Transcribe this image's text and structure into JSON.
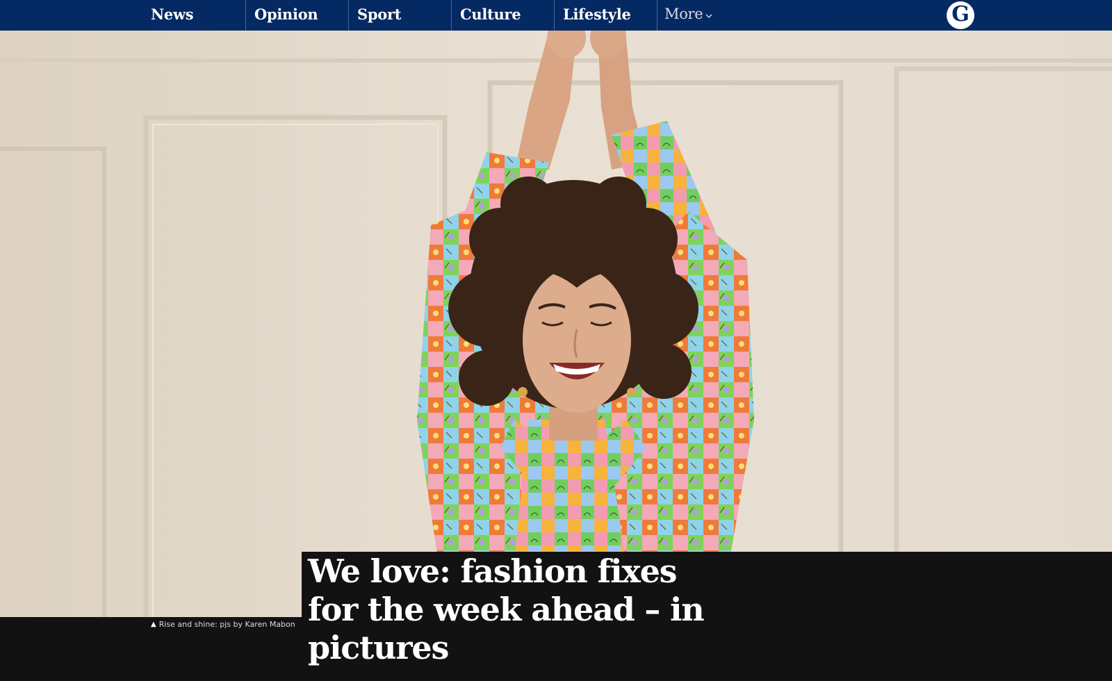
{
  "nav": {
    "items": [
      {
        "label": "News"
      },
      {
        "label": "Opinion"
      },
      {
        "label": "Sport"
      },
      {
        "label": "Culture"
      },
      {
        "label": "Lifestyle"
      }
    ],
    "more_label": "More",
    "logo_glyph": "G"
  },
  "hero": {
    "image": "woman in colorful patchwork print pyjamas with curly hair, arms raised, smiling"
  },
  "caption": {
    "icon": "triangle-up-icon",
    "text": "Rise and shine: pjs by Karen Mabon"
  },
  "article": {
    "headline": "We love: fashion fixes for the week ahead – in pictures"
  },
  "colors": {
    "nav_bg": "#052962",
    "band_bg": "#121212",
    "wall": "#e6dccf"
  }
}
